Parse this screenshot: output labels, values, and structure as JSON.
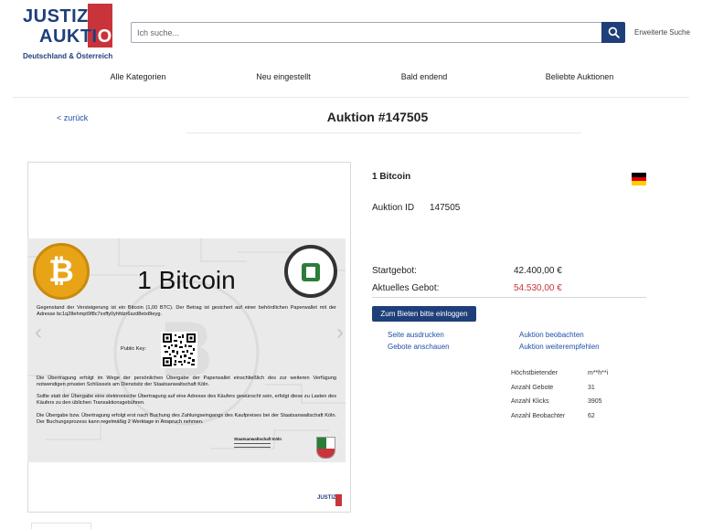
{
  "logo": {
    "line1": "JUSTIZ",
    "line2": "AUKTI",
    "line2_accent": "ON",
    "subtitle": "Deutschland & Österreich",
    "mini": "JUSTIZ"
  },
  "search": {
    "placeholder": "Ich suche...",
    "advanced": "Erweiterte Suche"
  },
  "nav": [
    "Alle Kategorien",
    "Neu eingestellt",
    "Bald endend",
    "Beliebte Auktionen"
  ],
  "back": "< zurück",
  "title": "Auktion #147505",
  "certificate": {
    "heading": "1 Bitcoin",
    "paragraph1": "Gegenstand der Versteigerung ist ein Bitcoin (1,00 BTC). Der Betrag ist gesichert auf einer behördlichen Paperwallet mit der Adresse bc1q28ehmpt9f8c7xxffy0yhfdzr6szd8etx8teyg.",
    "public_key_label": "Public Key:",
    "paragraph2": "Die Übertragung erfolgt im Wege der persönlichen Übergabe der Paperwallet einschließlich des zur weiteren Verfügung notwendigen privaten Schlüssels am Dienstsitz der Staatsanwaltschaft Köln.",
    "paragraph3": "Sollte statt der Übergabe eine elektronische Übertragung auf eine Adresse des Käufers gewünscht sein, erfolgt diese zu Lasten des Käufers zu den üblichen Transaktionsgebühren.",
    "paragraph4": "Die Übergabe bzw. Übertragung erfolgt erst nach Buchung des Zahlungseingangs des Kaufpreises bei der Staatsanwaltschaft Köln. Der Buchungsprozess kann regelmäßig 2 Werktage in Anspruch nehmen.",
    "authority": "Staatsanwaltschaft Köln"
  },
  "product": {
    "name": "1 Bitcoin",
    "auction_id_label": "Auktion ID",
    "auction_id": "147505",
    "start_bid_label": "Startgebot:",
    "start_bid": "42.400,00 €",
    "current_bid_label": "Aktuelles Gebot:",
    "current_bid": "54.530,00 €",
    "bid_button": "Zum Bieten bitte einloggen"
  },
  "links": {
    "print": "Seite ausdrucken",
    "watch": "Auktion beobachten",
    "bids": "Gebote anschauen",
    "recommend": "Auktion weiterempfehlen"
  },
  "stats": [
    {
      "label": "Höchstbietender",
      "value": "m**h**i"
    },
    {
      "label": "Anzahl Gebote",
      "value": "31"
    },
    {
      "label": "Anzahl Klicks",
      "value": "3905"
    },
    {
      "label": "Anzahl Beobachter",
      "value": "62"
    }
  ],
  "colors": {
    "brand_blue": "#1f3f7a",
    "brand_red": "#c8343a",
    "link_blue": "#1f4fa8",
    "bitcoin_orange": "#e8a317"
  },
  "flag_colors": [
    "#000000",
    "#dd0000",
    "#ffce00"
  ]
}
